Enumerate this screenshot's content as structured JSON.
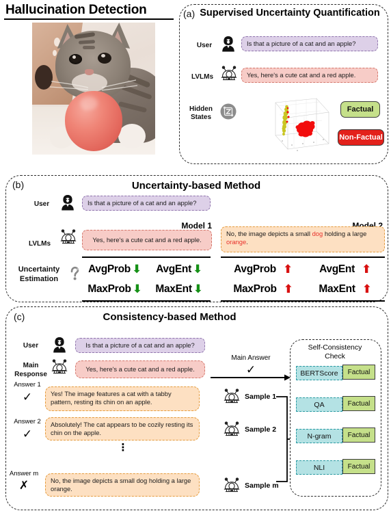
{
  "title": "Hallucination Detection",
  "photo": {
    "alt": "cat resting chin on an apple"
  },
  "shared": {
    "user_question": "Is that a picture of a cat and an apple?",
    "correct_answer": "Yes, here's a cute cat and a red apple.",
    "hallucinated_prefix": "No, the image depicts a small ",
    "hallucinated_word1": "dog",
    "hallucinated_mid": " holding a large ",
    "hallucinated_word2": "orange",
    "hallucinated_suffix": ".",
    "hallucinated_full": "No, the image depicts a small dog holding a large orange.",
    "label_user": "User",
    "label_lvlms": "LVLMs",
    "icon_user": "user-avatar-icon",
    "icon_lvlm": "robot-icon",
    "check_mark": "✓",
    "cross_mark": "✗"
  },
  "panel_a": {
    "tag": "(a)",
    "heading": "Supervised Uncertainty Quantification",
    "label_hidden_states_line1": "Hidden",
    "label_hidden_states_line2": "States",
    "icon_hidden_states": "hidden-states-icon",
    "scatter": {
      "name": "hidden-states-3d-scatter",
      "cluster_factual_color": "#c9c623",
      "cluster_nonfactual_color": "#f20d0d"
    },
    "badge_factual": "Factual",
    "badge_nonfactual": "Non-Factual",
    "color_factual": "#c5e08a",
    "color_nonfactual": "#e3211b"
  },
  "panel_b": {
    "tag": "(b)",
    "heading": "Uncertainty-based Method",
    "label_uncertainty_line1": "Uncertainty",
    "label_uncertainty_line2": "Estimation",
    "icon_uncertainty": "question-mark-icon",
    "model1_label": "Model 1",
    "model2_label": "Model 2",
    "metrics_model1": [
      {
        "name": "AvgProb",
        "direction": "down"
      },
      {
        "name": "AvgEnt",
        "direction": "down"
      },
      {
        "name": "MaxProb",
        "direction": "down"
      },
      {
        "name": "MaxEnt",
        "direction": "down"
      }
    ],
    "metrics_model2": [
      {
        "name": "AvgProb",
        "direction": "up"
      },
      {
        "name": "AvgEnt",
        "direction": "up"
      },
      {
        "name": "MaxProb",
        "direction": "up"
      },
      {
        "name": "MaxEnt",
        "direction": "up"
      }
    ],
    "arrow_down_glyph": "⬇",
    "arrow_up_glyph": "⬆",
    "arrow_down_color": "#159016",
    "arrow_up_color": "#d81111"
  },
  "panel_c": {
    "tag": "(c)",
    "heading": "Consistency-based Method",
    "label_main_response_line1": "Main",
    "label_main_response_line2": "Response",
    "main_answer_label": "Main Answer",
    "answers": [
      {
        "label": "Answer 1",
        "mark": "✓",
        "text": "Yes! The image features a cat with a tabby pattern, resting its chin on an apple.",
        "sample": "Sample 1"
      },
      {
        "label": "Answer 2",
        "mark": "✓",
        "text": "Absolutely! The cat appears to be cozily resting its chin on the apple.",
        "sample": "Sample 2"
      },
      {
        "label": "Answer m",
        "mark": "✗",
        "text": "No, the image depicts a small dog holding a large orange.",
        "sample": "Sample m"
      }
    ],
    "ellipsis": "⋮",
    "scc_title_line1": "Self-Consistency",
    "scc_title_line2": "Check",
    "scc_rows": [
      {
        "metric": "BERTScore",
        "verdict": "Factual"
      },
      {
        "metric": "QA",
        "verdict": "Factual"
      },
      {
        "metric": "N-gram",
        "verdict": "Factual"
      },
      {
        "metric": "NLI",
        "verdict": "Factual"
      }
    ],
    "chip_color": "#b4e2e4",
    "verdict_color": "#c5e08a"
  }
}
